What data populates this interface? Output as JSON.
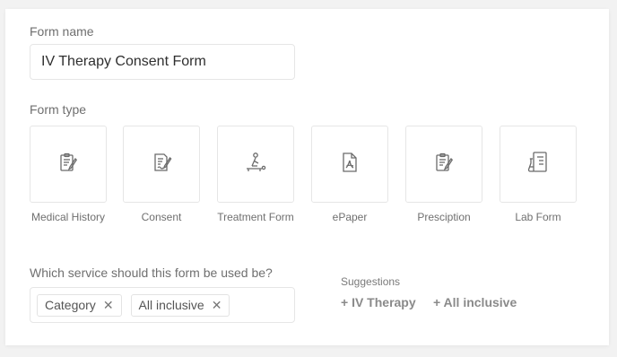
{
  "form_name": {
    "label": "Form name",
    "value": "IV Therapy Consent Form"
  },
  "form_type": {
    "label": "Form type",
    "options": [
      {
        "label": "Medical History",
        "icon": "clipboard-pen-icon"
      },
      {
        "label": "Consent",
        "icon": "document-pen-icon"
      },
      {
        "label": "Treatment Form",
        "icon": "treatment-person-icon"
      },
      {
        "label": "ePaper",
        "icon": "pdf-file-icon"
      },
      {
        "label": "Presciption",
        "icon": "clipboard-pen-icon"
      },
      {
        "label": "Lab Form",
        "icon": "lab-flask-icon"
      }
    ]
  },
  "service": {
    "label": "Which service should this form be used be?",
    "tags": [
      {
        "label": "Category"
      },
      {
        "label": "All inclusive"
      }
    ],
    "remove_glyph": "✕"
  },
  "suggestions": {
    "title": "Suggestions",
    "items": [
      "+ IV Therapy",
      "+ All inclusive"
    ]
  },
  "colors": {
    "icon_stroke": "#6b6b6b",
    "border": "#e6e6e6",
    "label_text": "#6f6f6f"
  }
}
